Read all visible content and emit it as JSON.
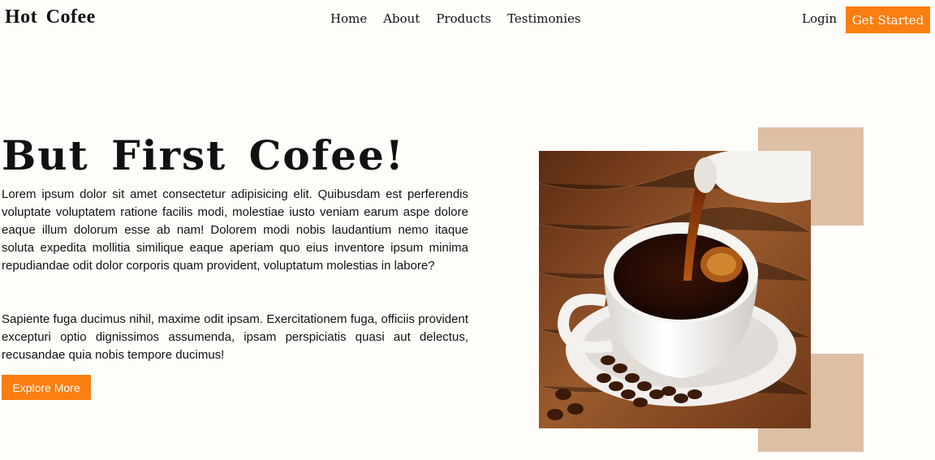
{
  "brand": {
    "name": "Hot Cofee"
  },
  "nav": {
    "items": [
      {
        "label": "Home"
      },
      {
        "label": "About"
      },
      {
        "label": "Products"
      },
      {
        "label": "Testimonies"
      }
    ],
    "login_label": "Login",
    "get_started_label": "Get Started"
  },
  "hero": {
    "title": "But First Cofee!",
    "paragraph_1": "Lorem ipsum dolor sit amet consectetur adipisicing elit. Quibusdam est perferendis voluptate voluptatem ratione facilis modi, molestiae iusto veniam earum aspe dolore eaque illum dolorum esse ab nam! Dolorem modi nobis laudantium nemo itaque soluta expedita mollitia similique eaque aperiam quo eius inventore ipsum minima repudiandae odit dolor corporis quam provident, voluptatum molestias in labore?",
    "paragraph_2": "Sapiente fuga ducimus nihil, maxime odit ipsam. Exercitationem fuga, officiis provident excepturi optio dignissimos assumenda, ipsam perspiciatis quasi aut delectus, recusandae quia nobis tempore ducimus!",
    "cta_label": "Explore More"
  },
  "image": {
    "subject": "coffee-cup-pour-photo"
  },
  "colors": {
    "accent": "#fb7e10",
    "background": "#fffdfa",
    "decor_block": "#dcbfa4"
  }
}
